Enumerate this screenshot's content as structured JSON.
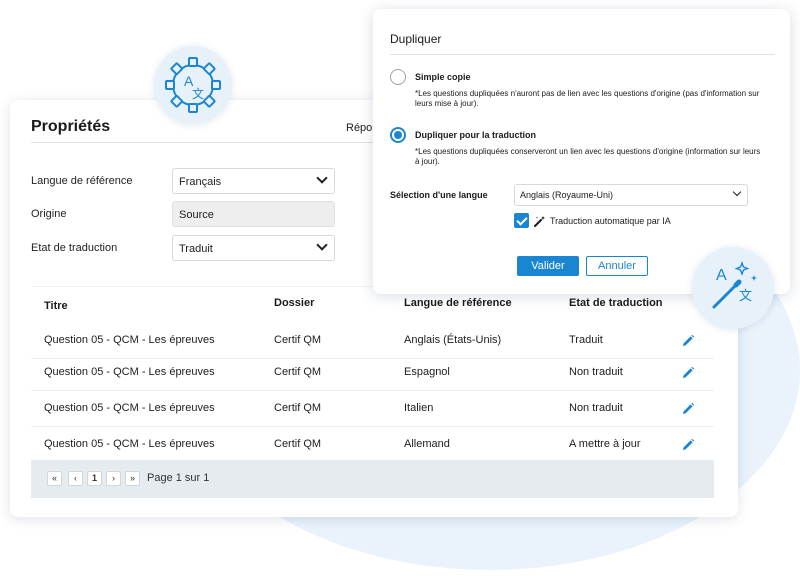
{
  "colors": {
    "accent": "#1a86d1",
    "blob": "#eaf3fb",
    "pager_bg": "#e6ebef"
  },
  "icons": {
    "translate_gear": "translate-gear-icon",
    "magic_translate": "magic-wand-translate-icon",
    "edit": "pencil-icon"
  },
  "properties": {
    "title": "Propriétés",
    "tab_partial": "Répon",
    "fields": {
      "reference_language_label": "Langue de référence",
      "reference_language_value": "Français",
      "origin_label": "Origine",
      "origin_value": "Source",
      "translation_state_label": "Etat de traduction",
      "translation_state_value": "Traduit"
    },
    "table": {
      "headers": [
        "Titre",
        "Dossier",
        "Langue de référence",
        "Etat de traduction"
      ],
      "rows": [
        {
          "title": "Question 05 - QCM -  Les épreuves",
          "folder": "Certif QM",
          "language": "Anglais (États-Unis)",
          "state": "Traduit"
        },
        {
          "title": "Question 05 - QCM -  Les épreuves",
          "folder": "Certif QM",
          "language": "Espagnol",
          "state": "Non traduit"
        },
        {
          "title": "Question 05 - QCM -  Les épreuves",
          "folder": "Certif QM",
          "language": "Italien",
          "state": "Non traduit"
        },
        {
          "title": "Question 05 - QCM -  Les épreuves",
          "folder": "Certif QM",
          "language": "Allemand",
          "state": "A mettre à jour"
        }
      ]
    },
    "pager": {
      "first": "«",
      "prev": "‹",
      "current": "1",
      "next": "›",
      "last": "»",
      "info": "Page 1 sur 1"
    }
  },
  "dialog": {
    "title": "Dupliquer",
    "option1_title": "Simple copie",
    "option1_desc": "*Les questions dupliquées n'auront pas de lien avec les questions d'origine (pas d'information sur leurs mise à jour).",
    "option2_title": "Dupliquer pour la traduction",
    "option2_desc": "*Les questions dupliquées conserveront un lien avec les questions d'origine (information sur leurs à jour).",
    "language_label": "Sélection d'une langue",
    "language_value": "Anglais (Royaume-Uni)",
    "auto_translate_label": "Traduction automatique par IA",
    "validate": "Valider",
    "cancel": "Annuler"
  }
}
